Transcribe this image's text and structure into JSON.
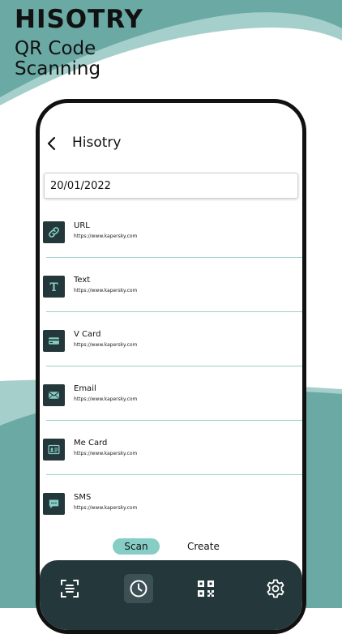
{
  "promo": {
    "title": "HISOTRY",
    "subtitle_line1": "QR Code",
    "subtitle_line2": "Scanning"
  },
  "colors": {
    "teal": "#6ba9a4",
    "teal_light": "#a5cfcb",
    "dark": "#24373a",
    "accent": "#86cdc5"
  },
  "header": {
    "back_icon": "chevron-left-icon",
    "title": "Hisotry"
  },
  "date": "20/01/2022",
  "items": [
    {
      "name": "URL",
      "url": "https://www.kapersky.com",
      "icon": "link-icon"
    },
    {
      "name": "Text",
      "url": "https://www.kapersky.com",
      "icon": "text-icon"
    },
    {
      "name": "V Card",
      "url": "https://www.kapersky.com",
      "icon": "card-icon"
    },
    {
      "name": "Email",
      "url": "https://www.kapersky.com",
      "icon": "email-icon"
    },
    {
      "name": "Me Card",
      "url": "https://www.kapersky.com",
      "icon": "id-card-icon"
    },
    {
      "name": "SMS",
      "url": "https://www.kapersky.com",
      "icon": "sms-icon"
    }
  ],
  "tabs": {
    "scan": "Scan",
    "create": "Create",
    "active": "scan"
  },
  "nav": [
    {
      "icon": "scan-icon",
      "active": false
    },
    {
      "icon": "clock-icon",
      "active": true
    },
    {
      "icon": "qr-code-icon",
      "active": false
    },
    {
      "icon": "gear-icon",
      "active": false
    }
  ]
}
